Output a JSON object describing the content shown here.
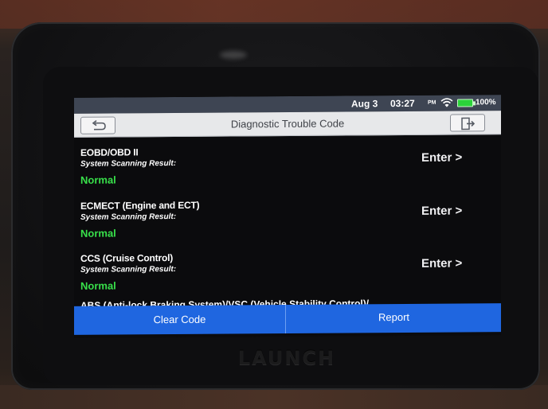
{
  "device": {
    "brand": "LAUNCH"
  },
  "statusbar": {
    "date": "Aug 3",
    "time": "03:27",
    "ampm": "PM",
    "battery": "100%",
    "battery_color": "#2bd33a",
    "wifi_icon": "wifi-icon",
    "battery_icon": "battery-icon"
  },
  "header": {
    "title": "Diagnostic Trouble Code",
    "back_icon": "back-arrow-icon",
    "exit_icon": "exit-icon"
  },
  "systems": [
    {
      "name": "EOBD/OBD II",
      "subtitle": "System Scanning Result:",
      "status": "Normal",
      "enter_label": "Enter >"
    },
    {
      "name": "ECMECT (Engine and ECT)",
      "subtitle": "System Scanning Result:",
      "status": "Normal",
      "enter_label": "Enter >"
    },
    {
      "name": "CCS (Cruise Control)",
      "subtitle": "System Scanning Result:",
      "status": "Normal",
      "enter_label": "Enter >"
    }
  ],
  "partial_row": {
    "name": "ABS (Anti-lock Braking System)/VSC (Vehicle Stability Control)/"
  },
  "footer": {
    "clear_label": "Clear Code",
    "report_label": "Report",
    "bar_color": "#1f66e0"
  },
  "colors": {
    "status_normal": "#38e04a",
    "statusbar_bg": "#3e4553"
  }
}
